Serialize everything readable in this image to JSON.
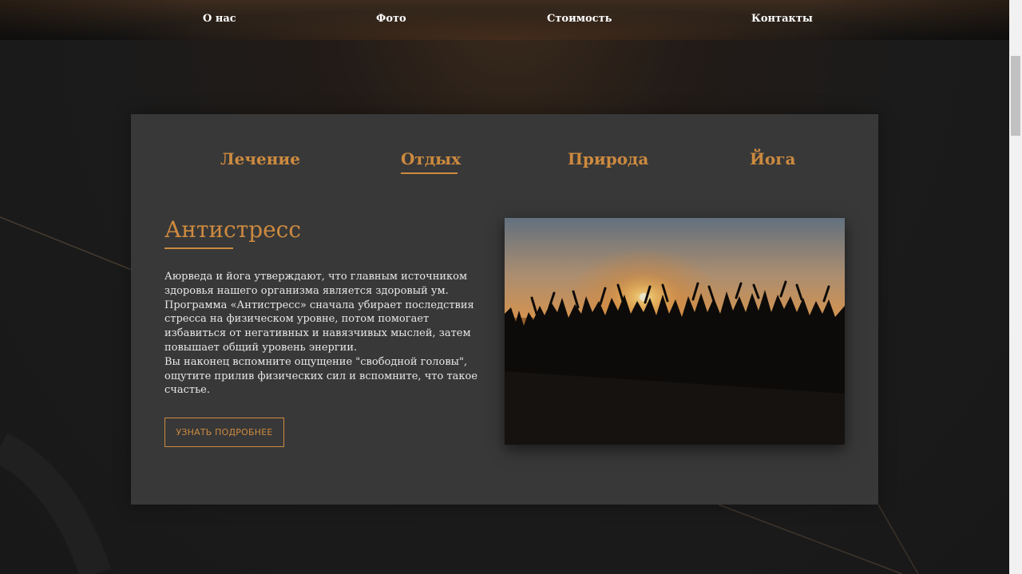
{
  "nav": {
    "items": [
      {
        "label": "О нас"
      },
      {
        "label": "Фото"
      },
      {
        "label": "Стоимость"
      },
      {
        "label": "Контакты"
      }
    ]
  },
  "tabs": {
    "items": [
      {
        "label": "Лечение"
      },
      {
        "label": "Отдых",
        "active": true
      },
      {
        "label": "Природа"
      },
      {
        "label": "Йога"
      }
    ]
  },
  "content": {
    "title": "Антистресс",
    "paragraphs": [
      "Аюрведа и йога утверждают, что главным источником здоровья нашего организма является здоровый ум.",
      "Программа «Антистресс» сначала убирает последствия стресса на физическом уровне, потом помогает избавиться от негативных и навязчивых мыслей, затем повышает общий уровень энергии.",
      "Вы наконец вспомните ощущение \"свободной головы\", ощутите прилив физических сил и вспомните, что такое счастье."
    ],
    "button_label": "УЗНАТЬ ПОДРОБНЕЕ",
    "photo_icon": "sunset-people-photo"
  },
  "colors": {
    "accent": "#cd8a3f",
    "card_bg": "#383838",
    "page_bg": "#1b1b1b",
    "text": "#e8e8e8"
  }
}
